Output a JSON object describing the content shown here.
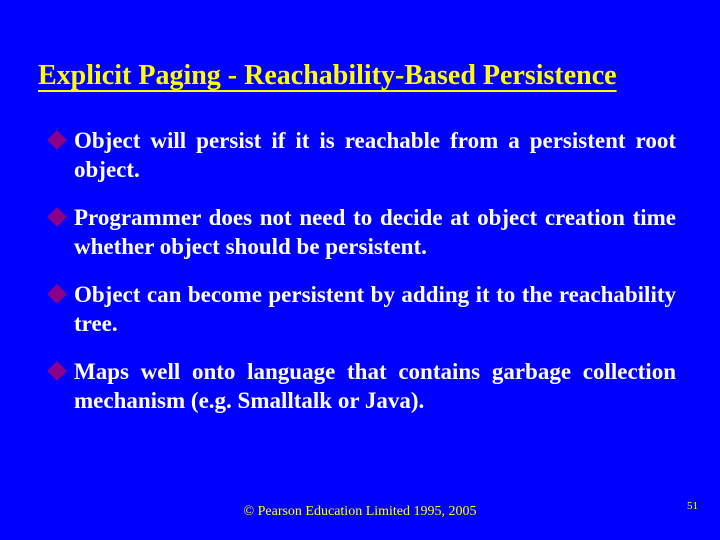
{
  "title": "Explicit Paging - Reachability-Based Persistence",
  "bullets": [
    "Object will persist if it is reachable from a persistent root object.",
    "Programmer does not need to decide at object creation time whether object should be persistent.",
    "Object can become persistent by adding it to the reachability tree.",
    "Maps well onto language that contains garbage collection mechanism (e.g. Smalltalk or Java)."
  ],
  "footer": "© Pearson Education Limited 1995, 2005",
  "page_number": "51"
}
